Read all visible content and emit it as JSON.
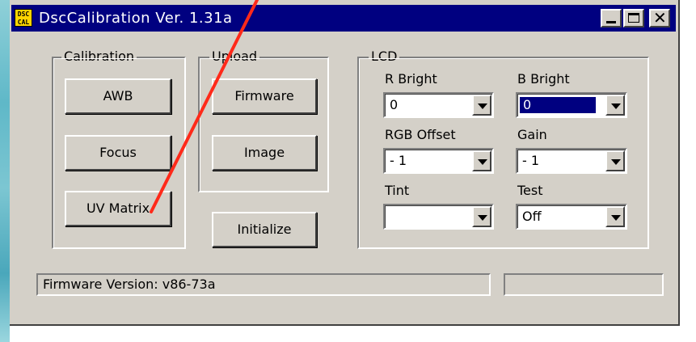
{
  "window": {
    "icon_text": "DSC CAL",
    "title": "DscCalibration  Ver. 1.31a",
    "icon": "dsc-calibration-app-icon"
  },
  "calibration": {
    "legend": "Calibration",
    "awb_label": "AWB",
    "focus_label": "Focus",
    "uv_matrix_label": "UV Matrix"
  },
  "upload": {
    "legend": "Upload",
    "firmware_label": "Firmware",
    "image_label": "Image"
  },
  "initialize_label": "Initialize",
  "lcd": {
    "legend": "LCD",
    "r_bright": {
      "label": "R Bright",
      "value": "0"
    },
    "b_bright": {
      "label": "B Bright",
      "value": "0"
    },
    "rgb_offset": {
      "label": "RGB Offset",
      "value": "- 1"
    },
    "gain": {
      "label": "Gain",
      "value": "- 1"
    },
    "tint": {
      "label": "Tint",
      "value": ""
    },
    "test": {
      "label": "Test",
      "value": "Off"
    }
  },
  "status": {
    "firmware_version": "Firmware Version: v86-73a",
    "secondary": ""
  },
  "colors": {
    "titlebar": "#000080",
    "face": "#d4d0c8",
    "annotation_arrow": "#ff2a1a"
  }
}
